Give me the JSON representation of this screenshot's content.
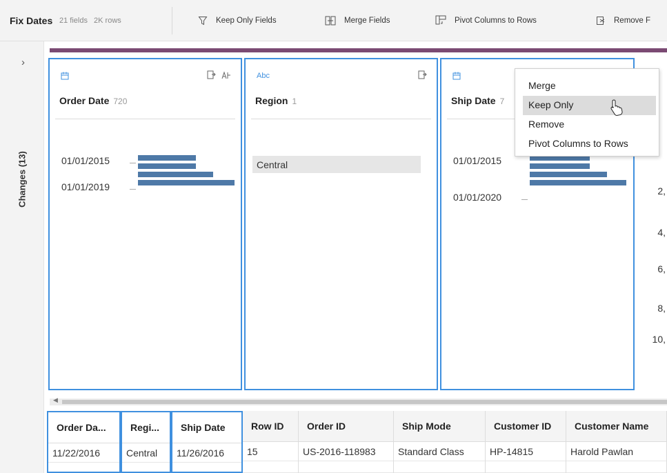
{
  "toolbar": {
    "step_name": "Fix Dates",
    "fields_count": "21 fields",
    "rows_count": "2K rows",
    "actions": [
      {
        "label": "Keep Only Fields",
        "icon": "filter-icon"
      },
      {
        "label": "Merge Fields",
        "icon": "merge-icon"
      },
      {
        "label": "Pivot Columns to Rows",
        "icon": "pivot-icon"
      },
      {
        "label": "Remove F",
        "icon": "remove-field-icon"
      }
    ]
  },
  "changes_panel": {
    "label": "Changes (13)",
    "icon": "chevron-right-icon"
  },
  "profile_cards": [
    {
      "type_icon": "calendar-icon",
      "type": "date",
      "name": "Order Date",
      "count": "720",
      "bin_labels": [
        "01/01/2015",
        "01/01/2019"
      ],
      "bars": [
        0.6,
        0.6,
        0.78,
        1.0
      ]
    },
    {
      "type_icon": "abc-icon",
      "type_label": "Abc",
      "type": "string",
      "name": "Region",
      "count": "1",
      "categories": [
        "Central"
      ]
    },
    {
      "type_icon": "calendar-icon",
      "type": "date",
      "name": "Ship Date",
      "count": "7",
      "bin_labels": [
        "01/01/2015",
        "01/01/2020"
      ],
      "bars": [
        0.62,
        0.62,
        0.8,
        1.0
      ]
    }
  ],
  "partial_card_values": [
    "2,",
    "4,",
    "6,",
    "8,",
    "10,"
  ],
  "context_menu": {
    "items": [
      "Merge",
      "Keep Only",
      "Remove",
      "Pivot Columns to Rows"
    ],
    "highlighted": "Keep Only"
  },
  "grid": {
    "columns": [
      "Order Da...",
      "Regi...",
      "Ship Date",
      "Row ID",
      "Order ID",
      "Ship Mode",
      "Customer ID",
      "Customer Name"
    ],
    "rows": [
      [
        "11/22/2016",
        "Central",
        "11/26/2016",
        "15",
        "US-2016-118983",
        "Standard Class",
        "HP-14815",
        "Harold Pawlan"
      ]
    ]
  },
  "colors": {
    "selection": "#3f90df",
    "bar": "#4e79a7",
    "accent_strip": "#7b4a73"
  }
}
